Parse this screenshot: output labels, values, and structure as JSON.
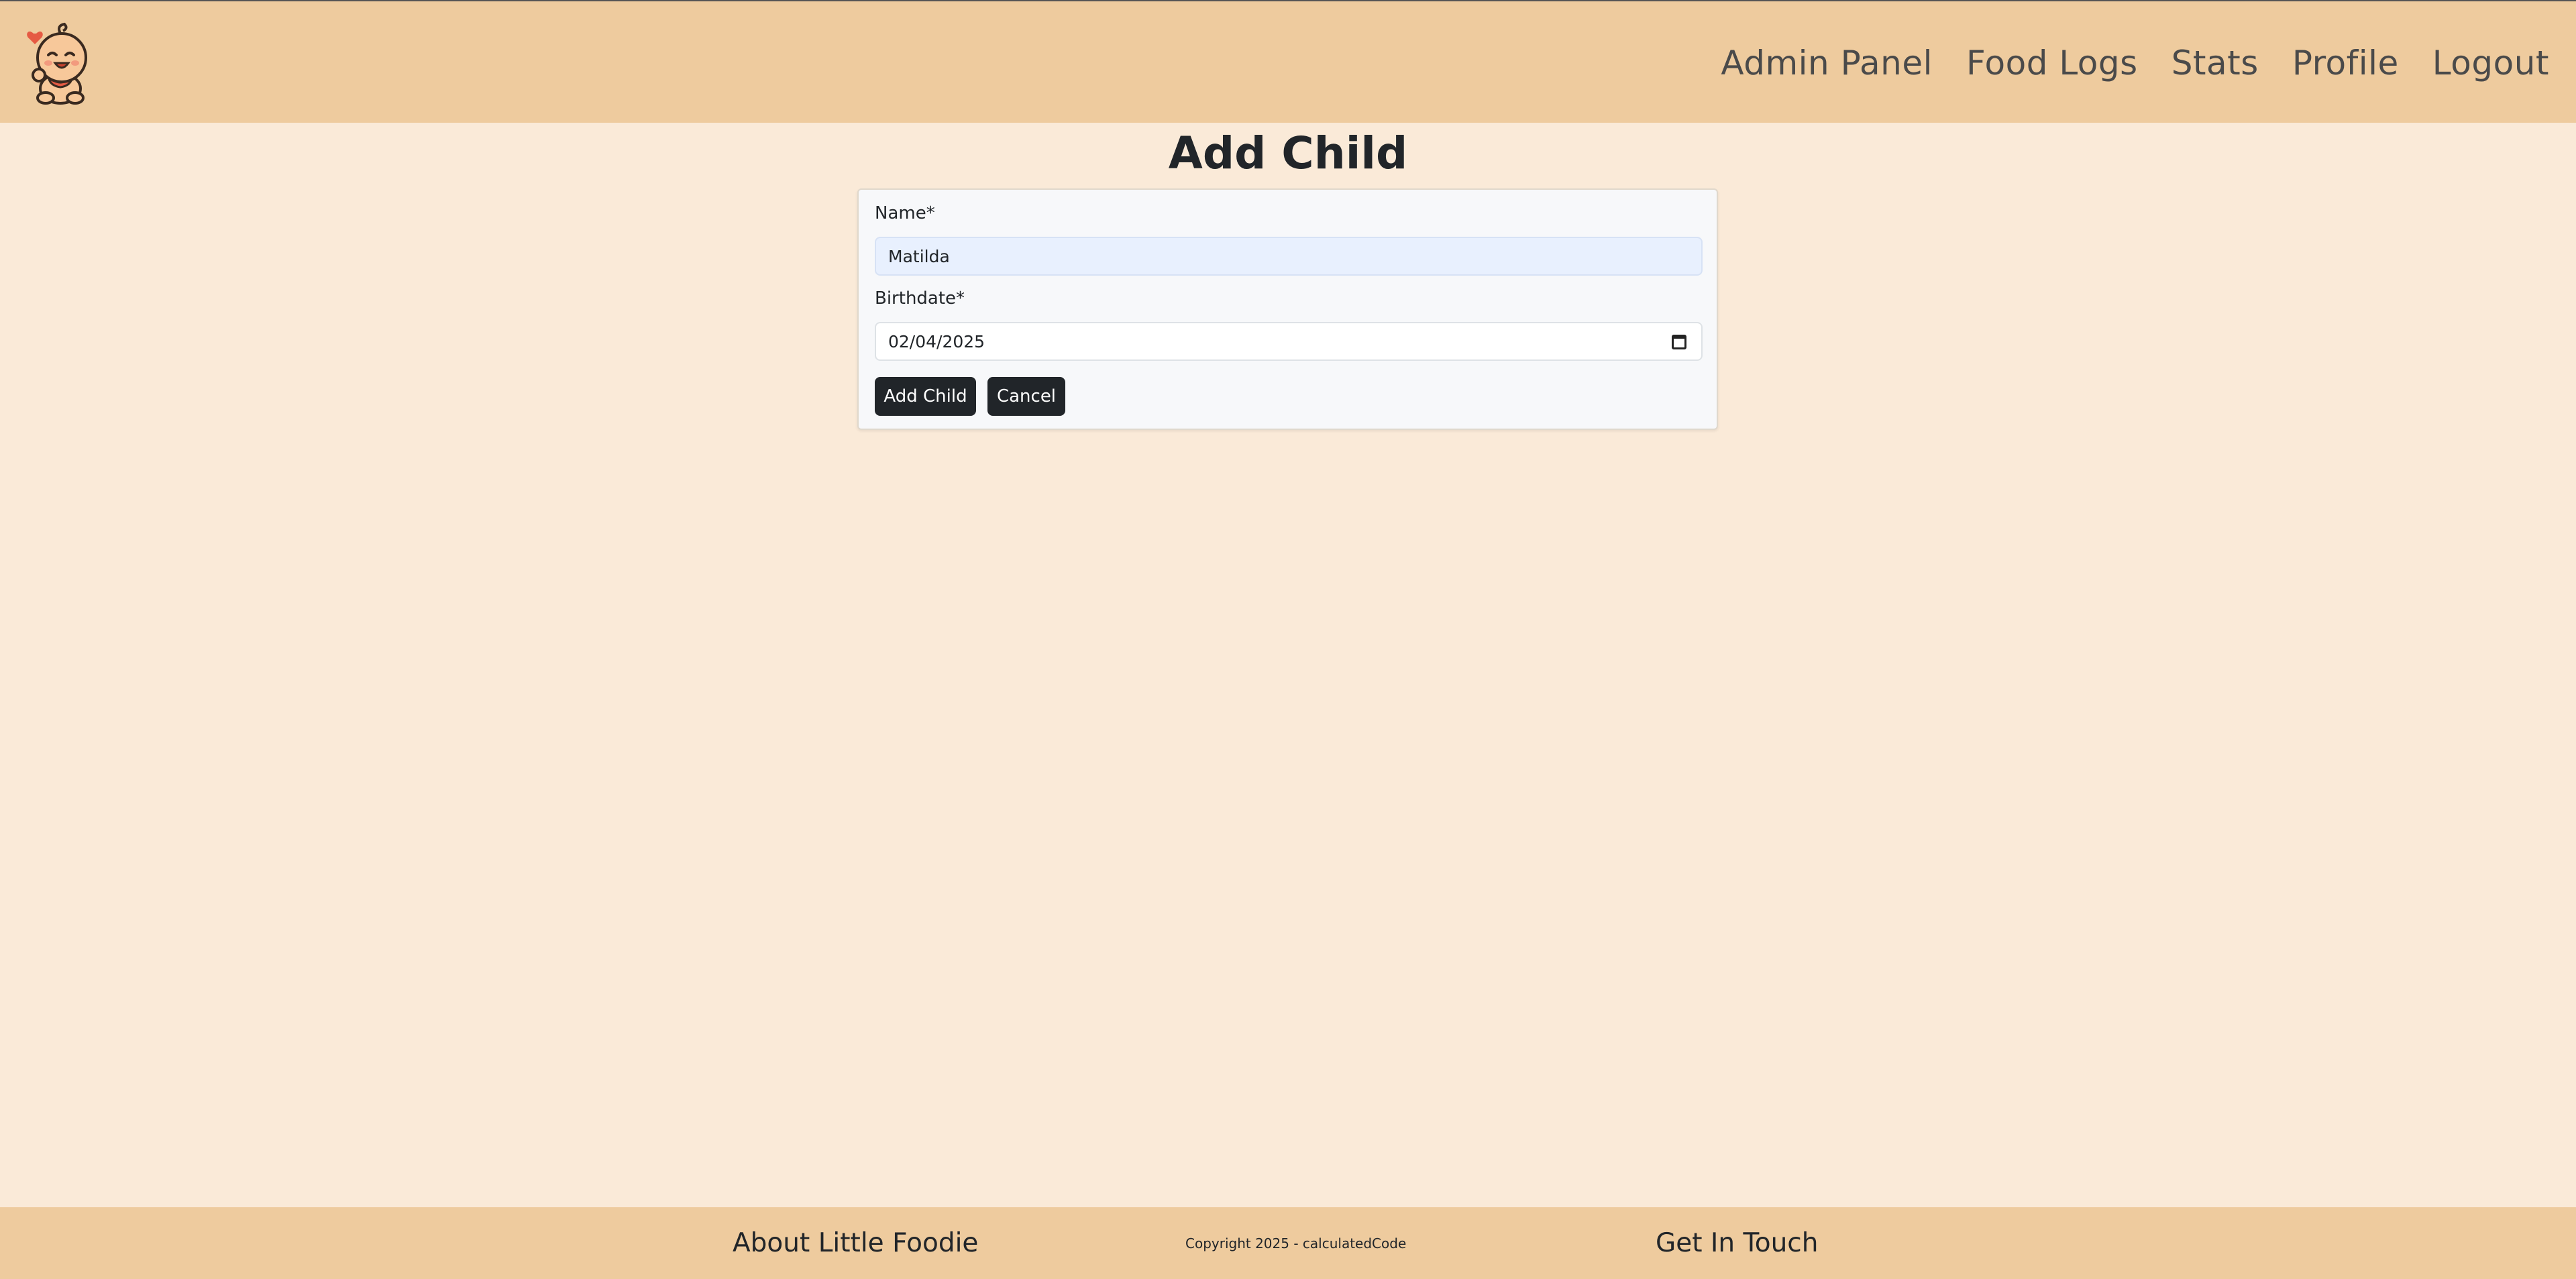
{
  "header": {
    "logo_icon": "baby-logo-icon",
    "nav": [
      "Admin Panel",
      "Food Logs",
      "Stats",
      "Profile",
      "Logout"
    ]
  },
  "page": {
    "title": "Add Child"
  },
  "form": {
    "name_label": "Name*",
    "name_value": "Matilda",
    "birthdate_label": "Birthdate*",
    "birthdate_value": "02/04/2025",
    "calendar_icon": "calendar-icon",
    "add_label": "Add Child",
    "cancel_label": "Cancel"
  },
  "footer": {
    "about": "About Little Foodie",
    "copyright": "Copyright 2025 - calculatedCode",
    "contact": "Get In Touch"
  },
  "colors": {
    "navbar": "#eecb9e",
    "background": "#faead8",
    "button": "#212529",
    "autofill": "#e8f0fe"
  }
}
